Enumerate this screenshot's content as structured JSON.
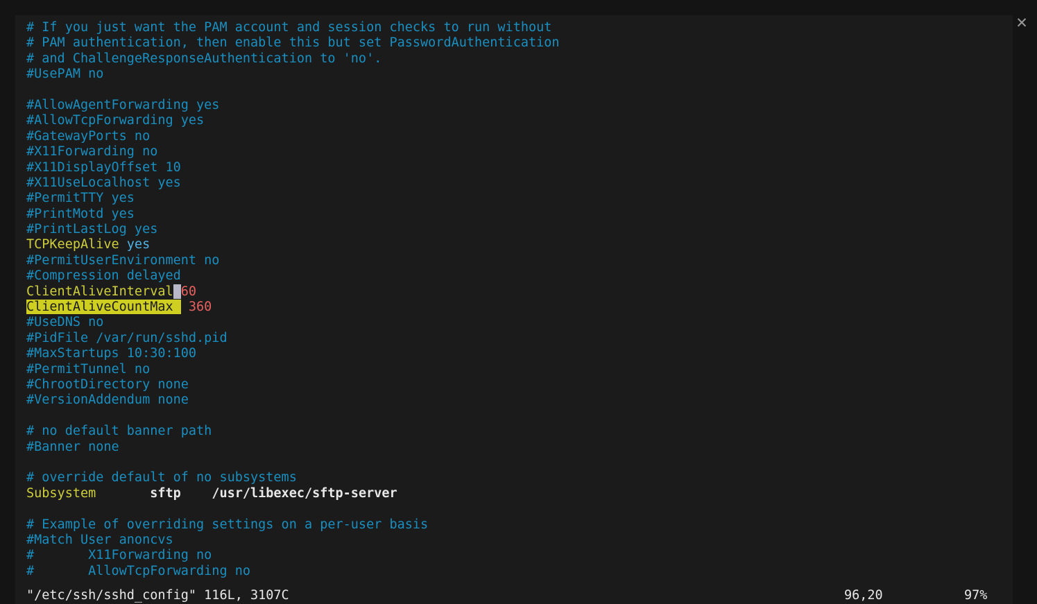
{
  "window": {
    "close_label": "✕"
  },
  "editor": {
    "name": "vim",
    "colors": {
      "background": "#1b1b1b",
      "backdrop": "#141414",
      "comment": "#1a8fc1",
      "keyword": "#cfcf3d",
      "value": "#4fb3e8",
      "number": "#e8605f",
      "plain": "#d6d6d6",
      "search_highlight_bg": "#cfcf22",
      "cursor_bg": "#b8b8c8"
    },
    "lines": [
      {
        "segments": [
          {
            "text": "# If you just want the PAM account and session checks to run without",
            "style": "comment"
          }
        ]
      },
      {
        "segments": [
          {
            "text": "# PAM authentication, then enable this but set PasswordAuthentication",
            "style": "comment"
          }
        ]
      },
      {
        "segments": [
          {
            "text": "# and ChallengeResponseAuthentication to 'no'.",
            "style": "comment"
          }
        ]
      },
      {
        "segments": [
          {
            "text": "#UsePAM no",
            "style": "comment"
          }
        ]
      },
      {
        "segments": [
          {
            "text": "",
            "style": "comment"
          }
        ]
      },
      {
        "segments": [
          {
            "text": "#AllowAgentForwarding yes",
            "style": "comment"
          }
        ]
      },
      {
        "segments": [
          {
            "text": "#AllowTcpForwarding yes",
            "style": "comment"
          }
        ]
      },
      {
        "segments": [
          {
            "text": "#GatewayPorts no",
            "style": "comment"
          }
        ]
      },
      {
        "segments": [
          {
            "text": "#X11Forwarding no",
            "style": "comment"
          }
        ]
      },
      {
        "segments": [
          {
            "text": "#X11DisplayOffset 10",
            "style": "comment"
          }
        ]
      },
      {
        "segments": [
          {
            "text": "#X11UseLocalhost yes",
            "style": "comment"
          }
        ]
      },
      {
        "segments": [
          {
            "text": "#PermitTTY yes",
            "style": "comment"
          }
        ]
      },
      {
        "segments": [
          {
            "text": "#PrintMotd yes",
            "style": "comment"
          }
        ]
      },
      {
        "segments": [
          {
            "text": "#PrintLastLog yes",
            "style": "comment"
          }
        ]
      },
      {
        "segments": [
          {
            "text": "TCPKeepAlive",
            "style": "keyword"
          },
          {
            "text": " ",
            "style": "plain"
          },
          {
            "text": "yes",
            "style": "value"
          }
        ]
      },
      {
        "segments": [
          {
            "text": "#PermitUserEnvironment no",
            "style": "comment"
          }
        ]
      },
      {
        "segments": [
          {
            "text": "#Compression delayed",
            "style": "comment"
          }
        ]
      },
      {
        "segments": [
          {
            "text": "ClientAliveInterval",
            "style": "keyword"
          },
          {
            "text": " ",
            "style": "cursor"
          },
          {
            "text": "60",
            "style": "number"
          }
        ]
      },
      {
        "segments": [
          {
            "text": "ClientAliveCountMax ",
            "style": "search"
          },
          {
            "text": " 360",
            "style": "number"
          }
        ]
      },
      {
        "segments": [
          {
            "text": "#UseDNS no",
            "style": "comment"
          }
        ]
      },
      {
        "segments": [
          {
            "text": "#PidFile /var/run/sshd.pid",
            "style": "comment"
          }
        ]
      },
      {
        "segments": [
          {
            "text": "#MaxStartups 10:30:100",
            "style": "comment"
          }
        ]
      },
      {
        "segments": [
          {
            "text": "#PermitTunnel no",
            "style": "comment"
          }
        ]
      },
      {
        "segments": [
          {
            "text": "#ChrootDirectory none",
            "style": "comment"
          }
        ]
      },
      {
        "segments": [
          {
            "text": "#VersionAddendum none",
            "style": "comment"
          }
        ]
      },
      {
        "segments": [
          {
            "text": "",
            "style": "comment"
          }
        ]
      },
      {
        "segments": [
          {
            "text": "# no default banner path",
            "style": "comment"
          }
        ]
      },
      {
        "segments": [
          {
            "text": "#Banner none",
            "style": "comment"
          }
        ]
      },
      {
        "segments": [
          {
            "text": "",
            "style": "comment"
          }
        ]
      },
      {
        "segments": [
          {
            "text": "# override default of no subsystems",
            "style": "comment"
          }
        ]
      },
      {
        "segments": [
          {
            "text": "Subsystem",
            "style": "keyword"
          },
          {
            "text": "\tsftp\t/usr/libexec/sftp-server",
            "style": "bold"
          }
        ]
      },
      {
        "segments": [
          {
            "text": "",
            "style": "comment"
          }
        ]
      },
      {
        "segments": [
          {
            "text": "# Example of overriding settings on a per-user basis",
            "style": "comment"
          }
        ]
      },
      {
        "segments": [
          {
            "text": "#Match User anoncvs",
            "style": "comment"
          }
        ]
      },
      {
        "segments": [
          {
            "text": "#\tX11Forwarding no",
            "style": "comment"
          }
        ]
      },
      {
        "segments": [
          {
            "text": "#\tAllowTcpForwarding no",
            "style": "comment"
          }
        ]
      }
    ]
  },
  "statusline": {
    "file": "\"/etc/ssh/sshd_config\" 116L, 3107C",
    "position": "96,20",
    "percent": "97%"
  }
}
